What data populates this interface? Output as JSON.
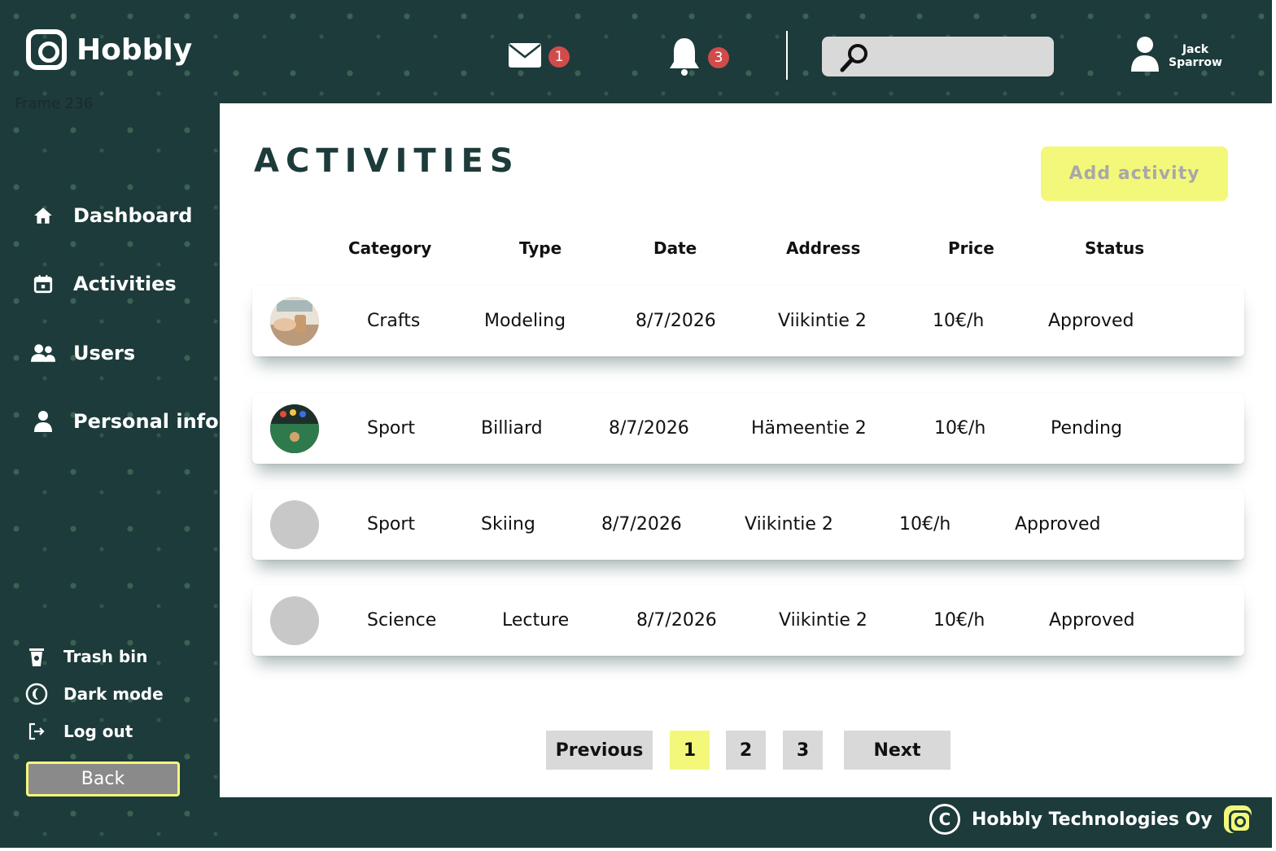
{
  "app": {
    "name": "Hobbly",
    "frame_label": "Frame 236"
  },
  "header": {
    "messages": {
      "icon": "mail-icon",
      "count": "1"
    },
    "notifications": {
      "icon": "bell-icon",
      "count": "3"
    },
    "search": {
      "icon": "search-icon",
      "placeholder": ""
    },
    "user": {
      "first": "Jack",
      "last": "Sparrow",
      "icon": "user-icon"
    }
  },
  "sidebar": {
    "nav": [
      {
        "label": "Dashboard",
        "icon": "home-icon"
      },
      {
        "label": "Activities",
        "icon": "calendar-icon"
      },
      {
        "label": "Users",
        "icon": "users-icon"
      },
      {
        "label": "Personal info",
        "icon": "person-icon"
      }
    ],
    "utilities": [
      {
        "label": "Trash bin",
        "icon": "trash-icon"
      },
      {
        "label": "Dark mode",
        "icon": "moon-icon"
      },
      {
        "label": "Log out",
        "icon": "logout-icon"
      }
    ],
    "back_label": "Back"
  },
  "main": {
    "title": "ACTIVITIES",
    "add_label": "Add activity",
    "columns": [
      "Category",
      "Type",
      "Date",
      "Address",
      "Price",
      "Status"
    ],
    "rows": [
      {
        "category": "Crafts",
        "type": "Modeling",
        "date": "8/7/2026",
        "address": "Viikintie 2",
        "price": "10€/h",
        "status": "Approved",
        "thumb": "crafts-photo"
      },
      {
        "category": "Sport",
        "type": "Billiard",
        "date": "8/7/2026",
        "address": "Hämeentie 2",
        "price": "10€/h",
        "status": "Pending",
        "thumb": "billiard-photo"
      },
      {
        "category": "Sport",
        "type": "Skiing",
        "date": "8/7/2026",
        "address": "Viikintie 2",
        "price": "10€/h",
        "status": "Approved",
        "thumb": "placeholder"
      },
      {
        "category": "Science",
        "type": "Lecture",
        "date": "8/7/2026",
        "address": "Viikintie 2",
        "price": "10€/h",
        "status": "Approved",
        "thumb": "placeholder"
      }
    ],
    "pagination": {
      "previous": "Previous",
      "pages": [
        "1",
        "2",
        "3"
      ],
      "current": "1",
      "next": "Next"
    }
  },
  "footer": {
    "company": "Hobbly Technologies Oy"
  },
  "colors": {
    "brand_dark": "#1c3b3a",
    "accent_yellow": "#f4f87a",
    "badge_red": "#d14b4b",
    "neutral_gray": "#d9d9d9"
  }
}
